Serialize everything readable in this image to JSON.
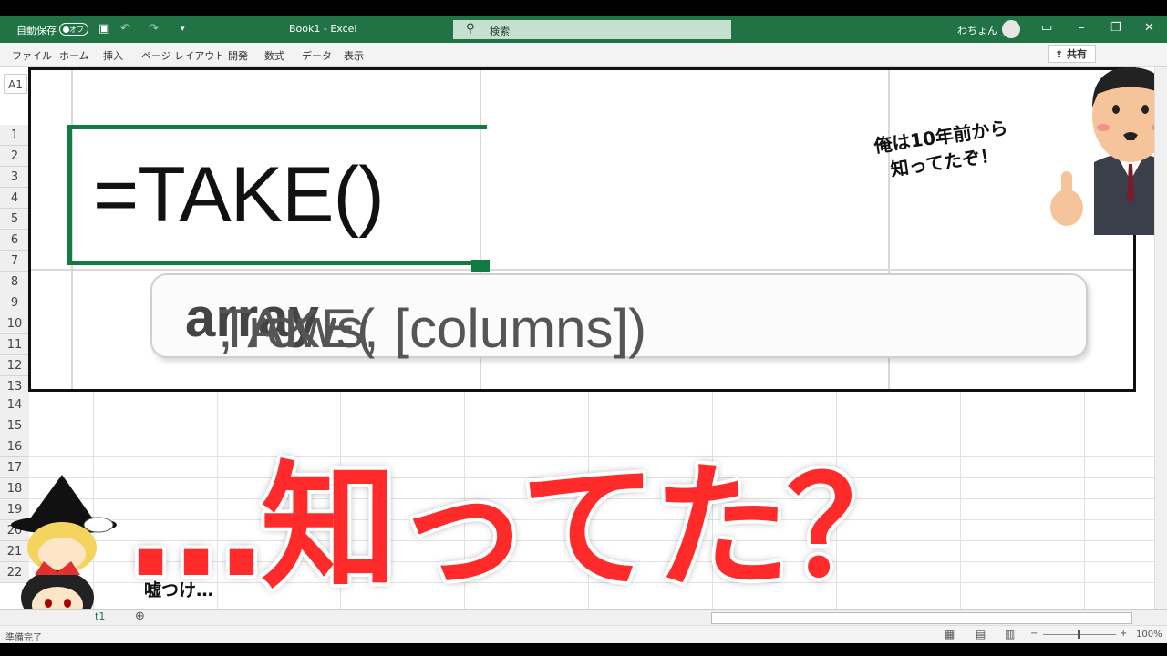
{
  "titlebar": {
    "autosave_label": "自動保存",
    "autosave_state": "オフ",
    "doc_title": "Book1  -  Excel",
    "search_placeholder": "検索",
    "user_name": "わちょん _"
  },
  "ribbon": {
    "tabs": [
      "ファイル",
      "ホーム",
      "挿入",
      "ページ レイアウト",
      "開発",
      "数式",
      "データ",
      "表示"
    ],
    "share_label": "共有"
  },
  "sheet": {
    "name_box": "A1",
    "row_numbers": [
      "1",
      "2",
      "3",
      "4",
      "5",
      "6",
      "7",
      "8",
      "9",
      "10",
      "11",
      "12",
      "13",
      "14",
      "15",
      "16",
      "17",
      "18",
      "19",
      "20",
      "21",
      "22"
    ],
    "active_tab": "t1",
    "status_text": "準備完了",
    "zoom_level": "100%"
  },
  "zoom_panel": {
    "formula": "=TAKE()",
    "tooltip_fn": "TAKE(",
    "tooltip_arg_bold": "array",
    "tooltip_rest": ", rows, [columns])"
  },
  "overlay": {
    "headline": "…知ってた？",
    "callout_line1": "俺は10年前から",
    "callout_line2": "知ってたぞ！",
    "mutter": "嘘つけ…"
  },
  "colors": {
    "excel_green": "#217346",
    "headline_red": "#ff2b2b"
  }
}
